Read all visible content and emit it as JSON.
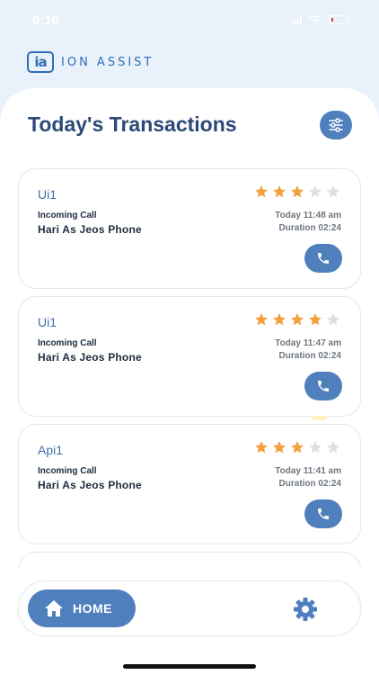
{
  "status_bar": {
    "time": "6:10"
  },
  "brand": {
    "logo_text": "ia",
    "name": "ION ASSIST",
    "color": "#2f6eb3"
  },
  "header": {
    "title": "Today's Transactions"
  },
  "colors": {
    "accent": "#4f7fbd",
    "star_filled": "#f0a03c",
    "star_empty": "#dcdfe3",
    "title": "#2c4a78"
  },
  "transactions": [
    {
      "name": "Ui1",
      "rating": 3,
      "max_rating": 5,
      "call_type": "Incoming Call",
      "caller": "Hari As Jeos Phone",
      "time": "Today 11:48 am",
      "duration": "Duration 02:24"
    },
    {
      "name": "Ui1",
      "rating": 4,
      "max_rating": 5,
      "call_type": "Incoming Call",
      "caller": "Hari As Jeos Phone",
      "time": "Today 11:47 am",
      "duration": "Duration 02:24"
    },
    {
      "name": "Api1",
      "rating": 3,
      "max_rating": 5,
      "call_type": "Incoming Call",
      "caller": "Hari As Jeos Phone",
      "time": "Today 11:41 am",
      "duration": "Duration 02:24"
    }
  ],
  "bottom_nav": {
    "home_label": "HOME",
    "home_icon": "home-icon",
    "settings_icon": "gear-icon"
  }
}
